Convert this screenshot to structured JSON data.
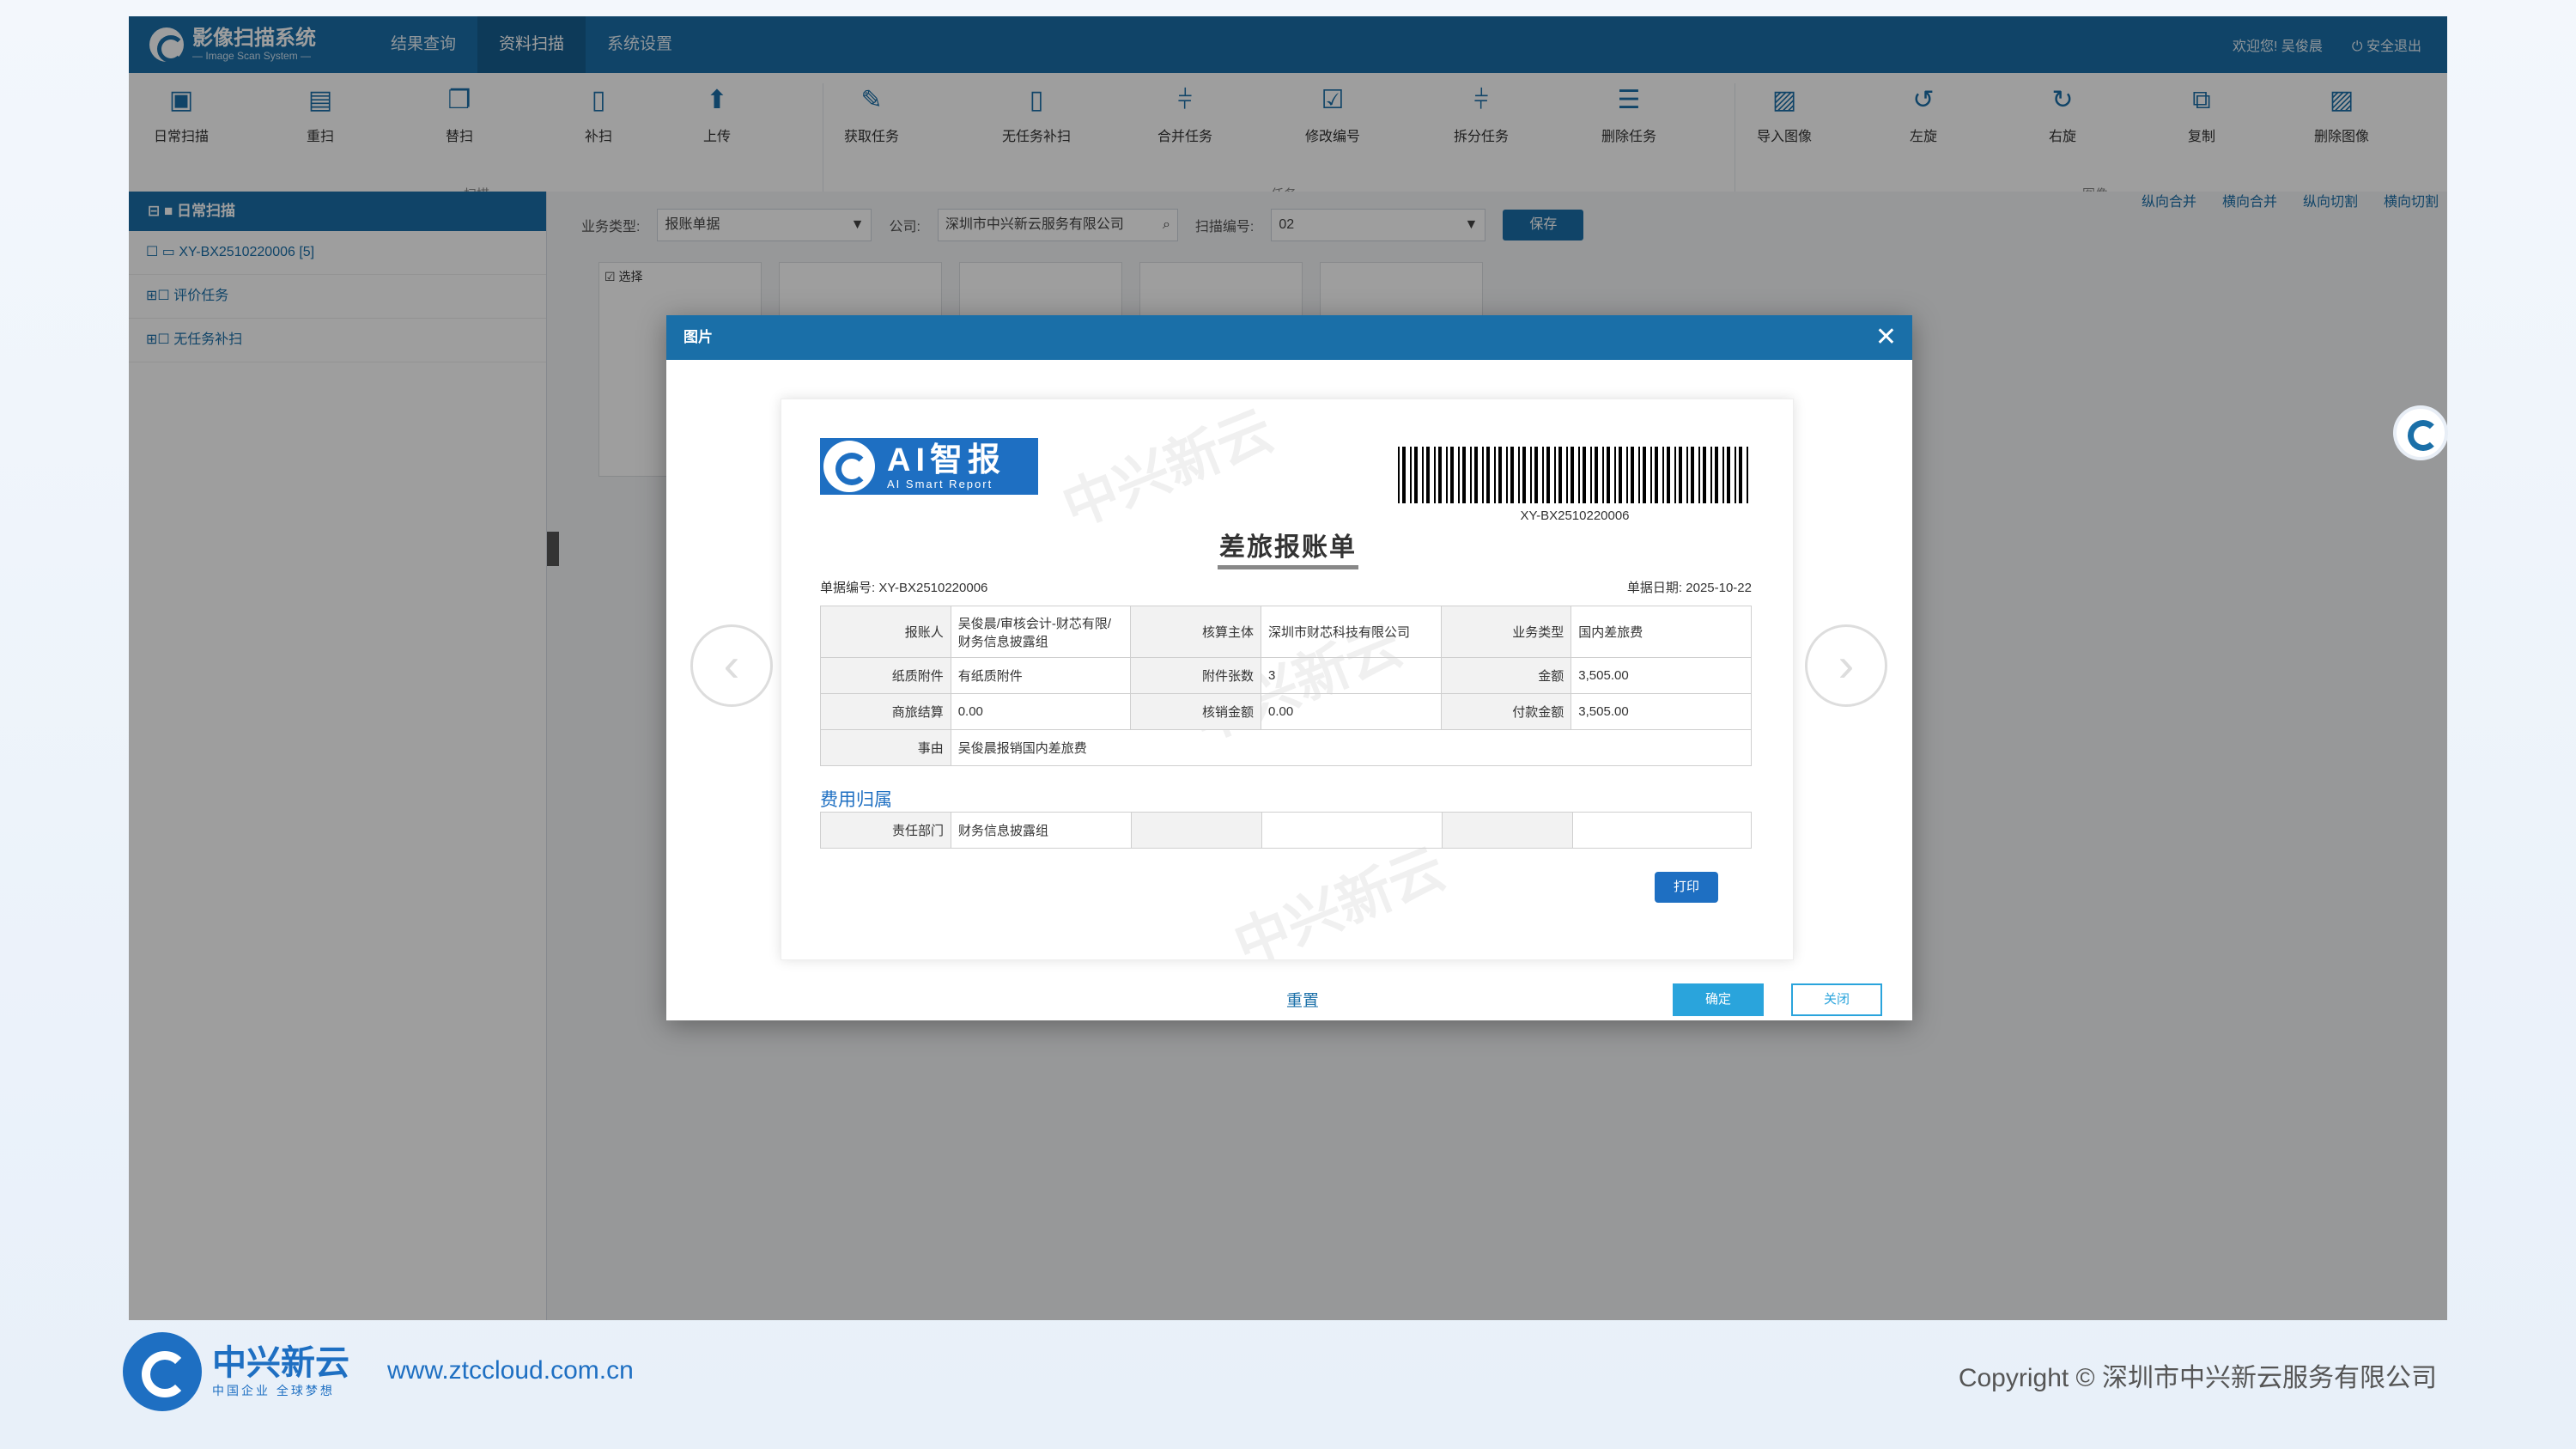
{
  "app": {
    "title": "影像扫描系统",
    "subtitle": "— Image Scan System —",
    "nav": [
      "结果查询",
      "资料扫描",
      "系统设置"
    ],
    "welcome": "欢迎您! 吴俊晨",
    "logout": "安全退出"
  },
  "toolbar": {
    "tools": [
      "日常扫描",
      "重扫",
      "替扫",
      "补扫",
      "上传",
      "获取任务",
      "无任务补扫",
      "合并任务",
      "修改编号",
      "拆分任务",
      "删除任务",
      "导入图像",
      "左旋",
      "右旋",
      "复制",
      "删除图像"
    ],
    "groups": [
      "扫描",
      "任务",
      "图像"
    ],
    "quick": [
      "纵向合并",
      "横向合并",
      "纵向切割",
      "横向切割"
    ]
  },
  "sidebar": {
    "head": "日常扫描",
    "items": [
      "XY-BX2510220006 [5]",
      "评价任务",
      "无任务补扫"
    ]
  },
  "filter": {
    "type_label": "业务类型:",
    "type_value": "报账单据",
    "company_label": "公司:",
    "company_value": "深圳市中兴新云服务有限公司",
    "scan_label": "扫描编号:",
    "scan_value": "02",
    "save": "保存",
    "select": "选择"
  },
  "modal": {
    "title": "图片",
    "reset": "重置",
    "ok": "确定",
    "close": "关闭"
  },
  "doc": {
    "logo_main": "AI智报",
    "logo_sub": "AI Smart Report",
    "barcode": "XY-BX2510220006",
    "title": "差旅报账单",
    "no_label": "单据编号: XY-BX2510220006",
    "date_label": "单据日期: 2025-10-22",
    "rows": [
      [
        "报账人",
        "吴俊晨/审核会计-财芯有限/财务信息披露组",
        "核算主体",
        "深圳市财芯科技有限公司",
        "业务类型",
        "国内差旅费"
      ],
      [
        "纸质附件",
        "有纸质附件",
        "附件张数",
        "3",
        "金额",
        "3,505.00"
      ],
      [
        "商旅结算",
        "0.00",
        "核销金额",
        "0.00",
        "付款金额",
        "3,505.00"
      ]
    ],
    "reason_label": "事由",
    "reason_value": "吴俊晨报销国内差旅费",
    "section": "费用归属",
    "dept_label": "责任部门",
    "dept_value": "财务信息披露组",
    "print": "打印"
  },
  "footer": {
    "brand": "中兴新云",
    "slogan": "中国企业 全球梦想",
    "url": "www.ztccloud.com.cn",
    "copyright": "Copyright © 深圳市中兴新云服务有限公司"
  }
}
